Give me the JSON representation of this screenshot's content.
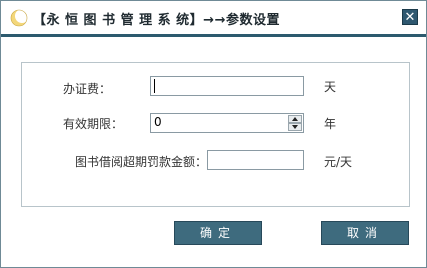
{
  "window": {
    "title": "【永 恒 图 书 管 理 系 统】→→参数设置",
    "close_glyph": "✕"
  },
  "form": {
    "fee": {
      "label": "办证费：",
      "value": "",
      "unit": "天"
    },
    "validity": {
      "label": "有效期限：",
      "value": "0",
      "unit": "年"
    },
    "fine": {
      "label": "图书借阅超期罚款金额：",
      "value": "",
      "unit": "元/天"
    }
  },
  "buttons": {
    "ok_label": "确定",
    "cancel_label": "取消"
  },
  "colors": {
    "title_underline": "#2c5a6e",
    "button_bg": "#3e6b7e"
  },
  "icons": {
    "app": "moon-icon",
    "close": "close-icon"
  }
}
